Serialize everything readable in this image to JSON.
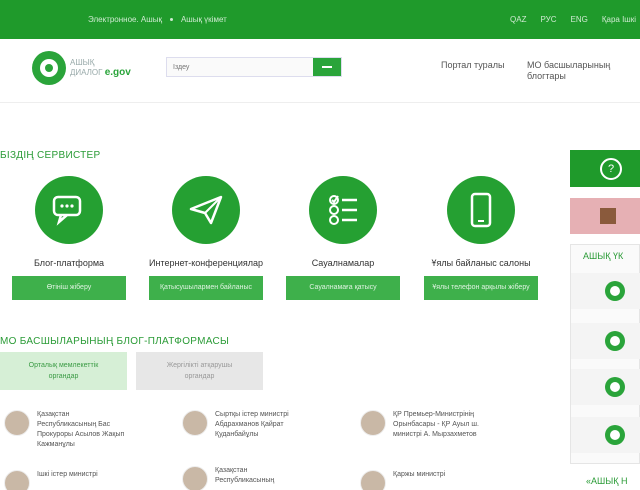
{
  "topbar": {
    "links": [
      "Электронное. Ашық",
      "Ашық үкімет"
    ],
    "languages": [
      "QAZ",
      "РУС",
      "ENG"
    ],
    "extra": "Қара Ішкі"
  },
  "header": {
    "logo_line1": "АШЫҚ",
    "logo_line2": "ДИАЛОГ",
    "logo_brand": "e.gov",
    "search_placeholder": "Іздеу",
    "nav_portal": "Портал туралы",
    "nav_heads_line1": "МО басшыларының",
    "nav_heads_line2": "блогтары"
  },
  "services": {
    "title": "БІЗДІҢ СЕРВИСТЕР",
    "items": [
      {
        "label": "Блог-платформа",
        "button": "Өтініш жіберу",
        "icon": "chat-icon"
      },
      {
        "label": "Интернет-конференциялар",
        "button": "Қатысушылармен байланыс",
        "icon": "paper-plane-icon"
      },
      {
        "label": "Сауалнамалар",
        "button": "Сауалнамаға қатысу",
        "icon": "checklist-icon"
      },
      {
        "label": "Ұялы байланыс салоны",
        "button": "Ұялы телефон арқылы жіберу",
        "icon": "mobile-phone-icon"
      }
    ]
  },
  "blogs": {
    "title": "МО БАСШЫЛАРЫНЫҢ БЛОГ-ПЛАТФОРМАСЫ",
    "tabs": [
      {
        "line1": "Орталық мемлекеттік",
        "line2": "органдар"
      },
      {
        "line1": "Жергілікті атқарушы",
        "line2": "органдар"
      }
    ],
    "items": [
      {
        "line1": "Қазақстан",
        "line2": "Республикасының Бас",
        "line3": "Прокуроры Асылов Жақып",
        "line4": "Кажманұлы"
      },
      {
        "line1": "Сыртқы істер министрі",
        "line2": "Абдрахманов Қайрат",
        "line3": "Қуданбайұлы",
        "line4": ""
      },
      {
        "line1": "ҚР Премьер-Министрінің",
        "line2": "Орынбасары - ҚР Ауыл ш.",
        "line3": "министрі А. Мырзахметов",
        "line4": ""
      },
      {
        "line1": "Ішкі істер министрі",
        "line2": "",
        "line3": "",
        "line4": ""
      },
      {
        "line1": "Қазақстан",
        "line2": "Республикасының",
        "line3": "",
        "line4": ""
      },
      {
        "line1": "Қаржы министрі",
        "line2": "",
        "line3": "",
        "line4": ""
      }
    ]
  },
  "right_panel": {
    "open_title": "АШЫҚ ҮК",
    "bottom_title": "«АШЫҚ Н"
  },
  "colors": {
    "brand": "#1f9a2b",
    "button": "#3eb04b",
    "tab_active": "#d6efd6"
  }
}
